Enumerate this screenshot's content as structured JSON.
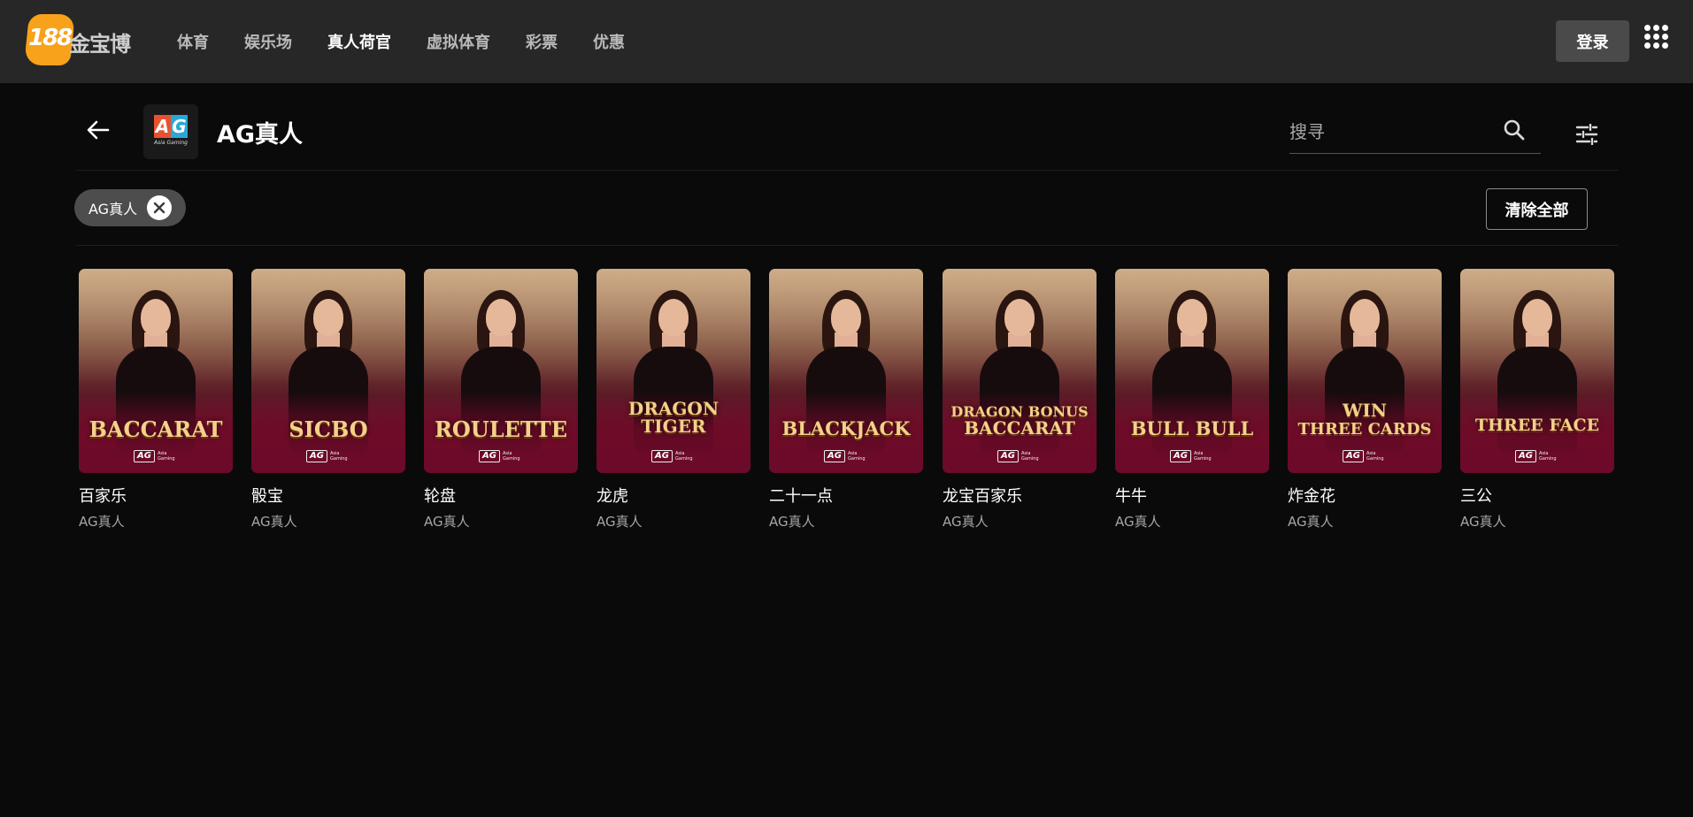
{
  "brand": {
    "logo_number": "188",
    "logo_text": "金宝博",
    "accent": "#f7a21a"
  },
  "nav": {
    "items": [
      {
        "label": "体育",
        "active": false
      },
      {
        "label": "娱乐场",
        "active": false
      },
      {
        "label": "真人荷官",
        "active": true
      },
      {
        "label": "虚拟体育",
        "active": false
      },
      {
        "label": "彩票",
        "active": false
      },
      {
        "label": "优惠",
        "active": false
      }
    ]
  },
  "header": {
    "login_label": "登录",
    "apps_icon": "grid-dots-icon"
  },
  "provider": {
    "logo_a": "A",
    "logo_g": "G",
    "logo_sub": "Asia Gaming",
    "title": "AG真人",
    "back_icon": "arrow-left-icon"
  },
  "search": {
    "placeholder": "搜寻",
    "icon": "search-icon",
    "filter_icon": "sliders-icon"
  },
  "filters": {
    "chip_label": "AG真人",
    "chip_close_icon": "close-circle-icon",
    "clear_label": "清除全部"
  },
  "games": [
    {
      "name": "百家乐",
      "provider": "AG真人",
      "art_lines": [
        "BACCARAT"
      ]
    },
    {
      "name": "骰宝",
      "provider": "AG真人",
      "art_lines": [
        "SICBO"
      ]
    },
    {
      "name": "轮盘",
      "provider": "AG真人",
      "art_lines": [
        "ROULETTE"
      ]
    },
    {
      "name": "龙虎",
      "provider": "AG真人",
      "art_lines": [
        "DRAGON",
        "TIGER"
      ]
    },
    {
      "name": "二十一点",
      "provider": "AG真人",
      "art_lines": [
        "BLACKJACK"
      ]
    },
    {
      "name": "龙宝百家乐",
      "provider": "AG真人",
      "art_lines": [
        "DRAGON BONUS",
        "BACCARAT"
      ]
    },
    {
      "name": "牛牛",
      "provider": "AG真人",
      "art_lines": [
        "BULL BULL"
      ]
    },
    {
      "name": "炸金花",
      "provider": "AG真人",
      "art_lines": [
        "WIN",
        "THREE CARDS"
      ]
    },
    {
      "name": "三公",
      "provider": "AG真人",
      "art_lines": [
        "THREE FACE"
      ]
    }
  ],
  "thumb_badge": {
    "mark": "AG",
    "sub_line1": "Asia",
    "sub_line2": "Gaming"
  }
}
